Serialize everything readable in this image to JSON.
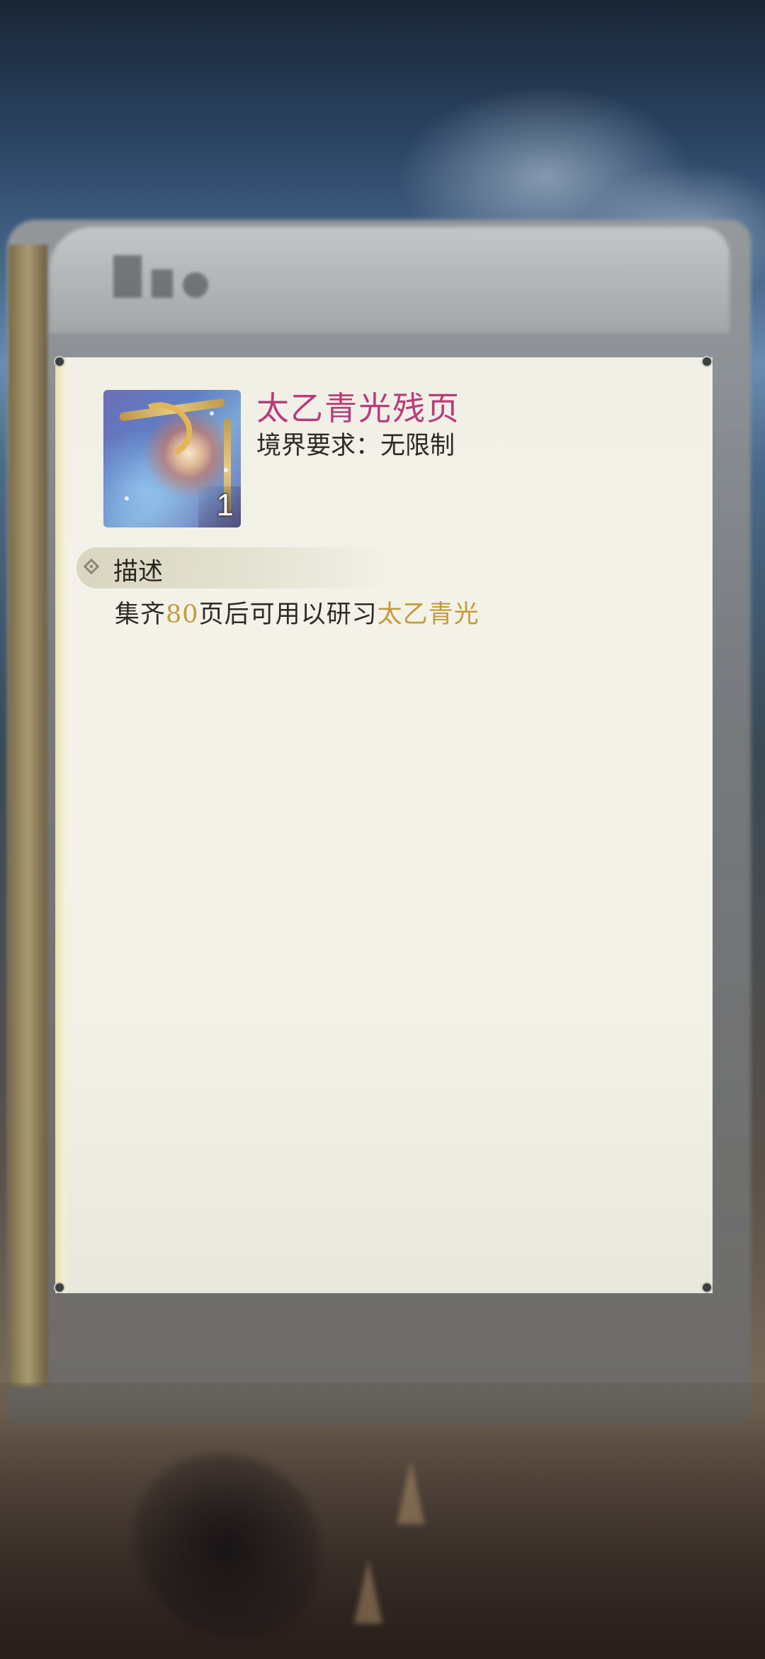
{
  "item": {
    "name": "太乙青光残页",
    "count": "1",
    "requirement": "境界要求：无限制"
  },
  "description_section": {
    "title": "描述",
    "text_prefix": "集齐",
    "quantity": "80",
    "text_middle": "页后可用以研习",
    "skill_name": "太乙青光"
  },
  "colors": {
    "item_name": "#b83c7a",
    "highlight_gold": "#c49a3c",
    "panel_bg": "#f2f1e6"
  }
}
